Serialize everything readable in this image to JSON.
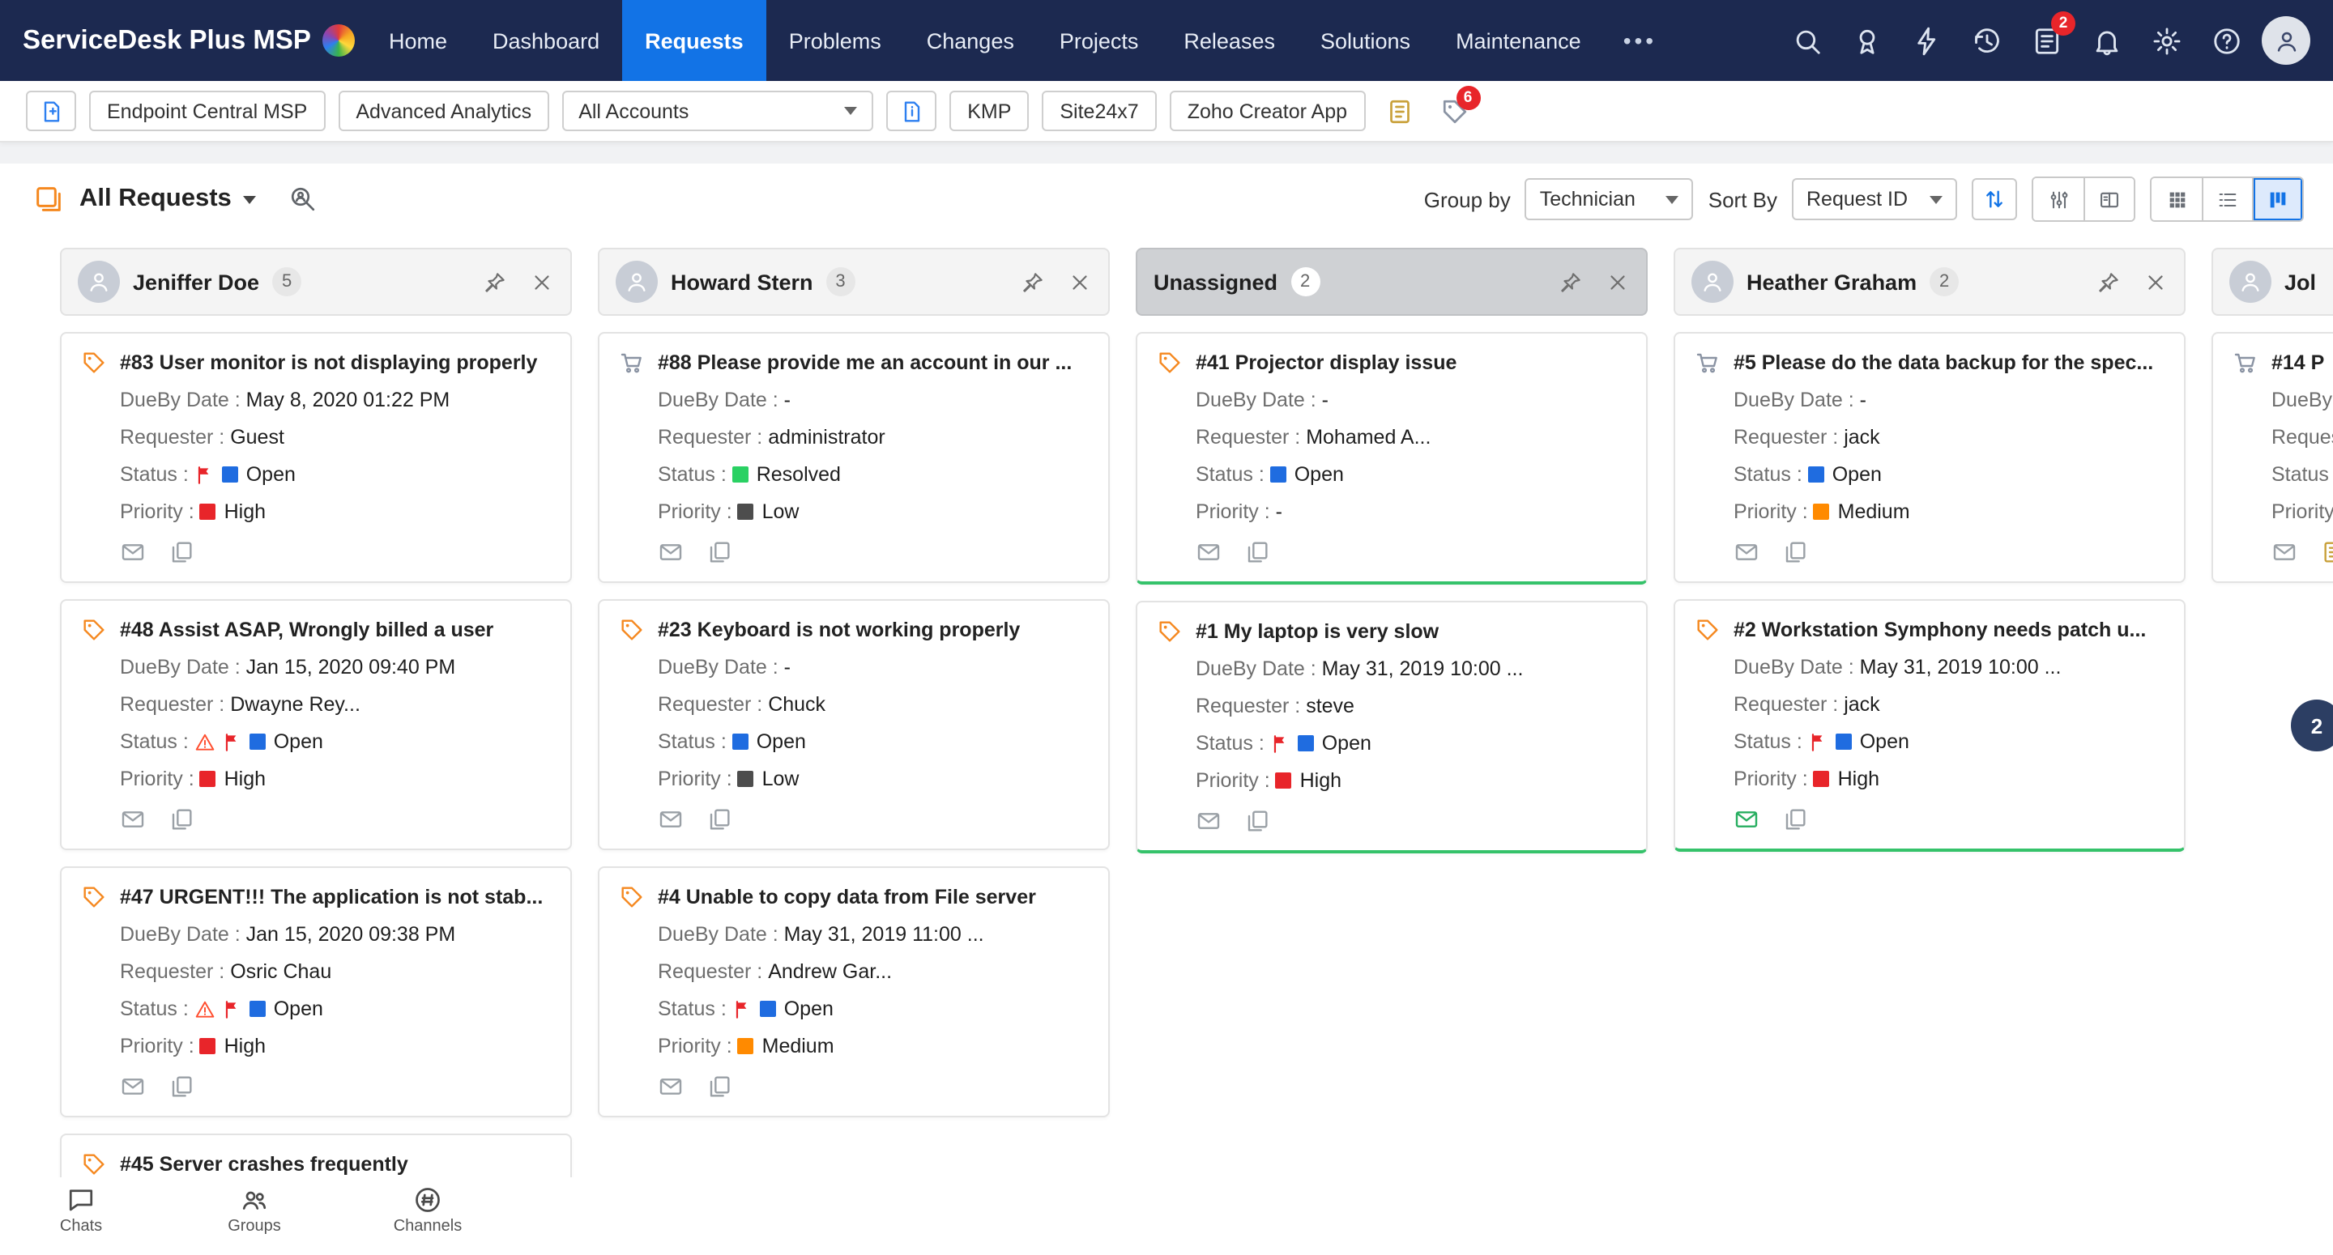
{
  "brand": {
    "name": "ServiceDesk Plus MSP"
  },
  "topnav": {
    "items": [
      {
        "label": "Home",
        "active": false
      },
      {
        "label": "Dashboard",
        "active": false
      },
      {
        "label": "Requests",
        "active": true
      },
      {
        "label": "Problems",
        "active": false
      },
      {
        "label": "Changes",
        "active": false
      },
      {
        "label": "Projects",
        "active": false
      },
      {
        "label": "Releases",
        "active": false
      },
      {
        "label": "Solutions",
        "active": false
      },
      {
        "label": "Maintenance",
        "active": false
      }
    ],
    "more_label": "•••",
    "icons": [
      {
        "name": "search"
      },
      {
        "name": "award"
      },
      {
        "name": "bolt"
      },
      {
        "name": "history"
      },
      {
        "name": "survey",
        "badge": "2"
      },
      {
        "name": "bell"
      },
      {
        "name": "gear"
      },
      {
        "name": "help"
      },
      {
        "name": "avatar"
      }
    ]
  },
  "toolbar": {
    "buttons": [
      "Endpoint Central MSP",
      "Advanced Analytics"
    ],
    "accounts_value": "All Accounts",
    "quick_links": [
      "KMP",
      "Site24x7",
      "Zoho Creator App"
    ],
    "tags_badge": "6"
  },
  "view_header": {
    "title": "All Requests",
    "group_by_label": "Group by",
    "group_by_value": "Technician",
    "sort_by_label": "Sort By",
    "sort_by_value": "Request ID"
  },
  "labels": {
    "dueby": "DueBy Date",
    "requester": "Requester",
    "status": "Status",
    "priority": "Priority"
  },
  "colors": {
    "open": "#1f6ce0",
    "resolved": "#2ad163",
    "high": "#e8252a",
    "medium": "#ff8a00",
    "low": "#4d4d4d",
    "flag": "#e8252a",
    "warning": "#ff4d2e",
    "accent": "#1273e6",
    "tag": "#f5881f",
    "cart": "#8a93a3",
    "green_edge": "#35c26a",
    "mail_green": "#27ae60"
  },
  "side_badge": "2",
  "board": {
    "columns": [
      {
        "name": "Jeniffer Doe",
        "count": "5",
        "selected": false,
        "avatar": true,
        "cards": [
          {
            "icon": "tag",
            "title": "#83 User monitor is not displaying properly",
            "dueby": "May 8, 2020 01:22 PM",
            "requester": "Guest",
            "status": "Open",
            "status_color": "open",
            "flag": true,
            "warning": false,
            "priority": "High",
            "priority_color": "high",
            "mail": "gray",
            "extra": "copy"
          },
          {
            "icon": "tag",
            "title": "#48 Assist ASAP, Wrongly billed a user",
            "dueby": "Jan 15, 2020 09:40 PM",
            "requester": "Dwayne Rey...",
            "status": "Open",
            "status_color": "open",
            "flag": true,
            "warning": true,
            "priority": "High",
            "priority_color": "high",
            "mail": "gray",
            "extra": "copy"
          },
          {
            "icon": "tag",
            "title": "#47 URGENT!!! The application is not stab...",
            "dueby": "Jan 15, 2020 09:38 PM",
            "requester": "Osric Chau",
            "status": "Open",
            "status_color": "open",
            "flag": true,
            "warning": true,
            "priority": "High",
            "priority_color": "high",
            "mail": "gray",
            "extra": "copy"
          },
          {
            "icon": "tag",
            "title": "#45 Server crashes frequently",
            "title_only": true
          }
        ]
      },
      {
        "name": "Howard Stern",
        "count": "3",
        "selected": false,
        "avatar": true,
        "cards": [
          {
            "icon": "cart",
            "title": "#88 Please provide me an account in our ...",
            "dueby": "-",
            "requester": "administrator",
            "status": "Resolved",
            "status_color": "resolved",
            "flag": false,
            "warning": false,
            "priority": "Low",
            "priority_color": "low",
            "mail": "gray",
            "extra": "copy"
          },
          {
            "icon": "tag",
            "title": "#23 Keyboard is not working properly",
            "dueby": "-",
            "requester": "Chuck",
            "status": "Open",
            "status_color": "open",
            "flag": false,
            "warning": false,
            "priority": "Low",
            "priority_color": "low",
            "mail": "gray",
            "extra": "copy"
          },
          {
            "icon": "tag",
            "title": "#4 Unable to copy data from File server",
            "dueby": "May 31, 2019 11:00 ...",
            "requester": "Andrew Gar...",
            "status": "Open",
            "status_color": "open",
            "flag": true,
            "warning": false,
            "priority": "Medium",
            "priority_color": "medium",
            "mail": "gray",
            "extra": "copy"
          }
        ]
      },
      {
        "name": "Unassigned",
        "count": "2",
        "selected": true,
        "avatar": false,
        "cards": [
          {
            "icon": "tag",
            "title": "#41 Projector display issue",
            "dueby": "-",
            "requester": "Mohamed A...",
            "status": "Open",
            "status_color": "open",
            "flag": false,
            "warning": false,
            "priority": "-",
            "priority_color": null,
            "mail": "gray",
            "extra": "copy",
            "green_edge": true
          },
          {
            "icon": "tag",
            "title": "#1 My laptop is very slow",
            "dueby": "May 31, 2019 10:00 ...",
            "requester": "steve",
            "status": "Open",
            "status_color": "open",
            "flag": true,
            "warning": false,
            "priority": "High",
            "priority_color": "high",
            "mail": "gray",
            "extra": "copy",
            "green_edge": true
          }
        ]
      },
      {
        "name": "Heather Graham",
        "count": "2",
        "selected": false,
        "avatar": true,
        "cards": [
          {
            "icon": "cart",
            "title": "#5 Please do the data backup for the spec...",
            "dueby": "-",
            "requester": "jack",
            "status": "Open",
            "status_color": "open",
            "flag": false,
            "warning": false,
            "priority": "Medium",
            "priority_color": "medium",
            "mail": "gray",
            "extra": "copy"
          },
          {
            "icon": "tag",
            "title": "#2 Workstation Symphony needs patch u...",
            "dueby": "May 31, 2019 10:00 ...",
            "requester": "jack",
            "status": "Open",
            "status_color": "open",
            "flag": true,
            "warning": false,
            "priority": "High",
            "priority_color": "high",
            "mail": "green",
            "extra": "copy",
            "green_edge": true
          }
        ]
      },
      {
        "name": "Jol",
        "count": "",
        "selected": false,
        "avatar": true,
        "cards": [
          {
            "icon": "cart",
            "title": "#14 P",
            "dueby": "",
            "requester": "",
            "status": "",
            "status_color": null,
            "flag": false,
            "warning": false,
            "priority": "",
            "priority_color": null,
            "mail": "gray",
            "extra": "note"
          }
        ]
      }
    ]
  },
  "dock": [
    {
      "icon": "chat",
      "label": "Chats"
    },
    {
      "icon": "groups",
      "label": "Groups"
    },
    {
      "icon": "channels",
      "label": "Channels"
    }
  ]
}
